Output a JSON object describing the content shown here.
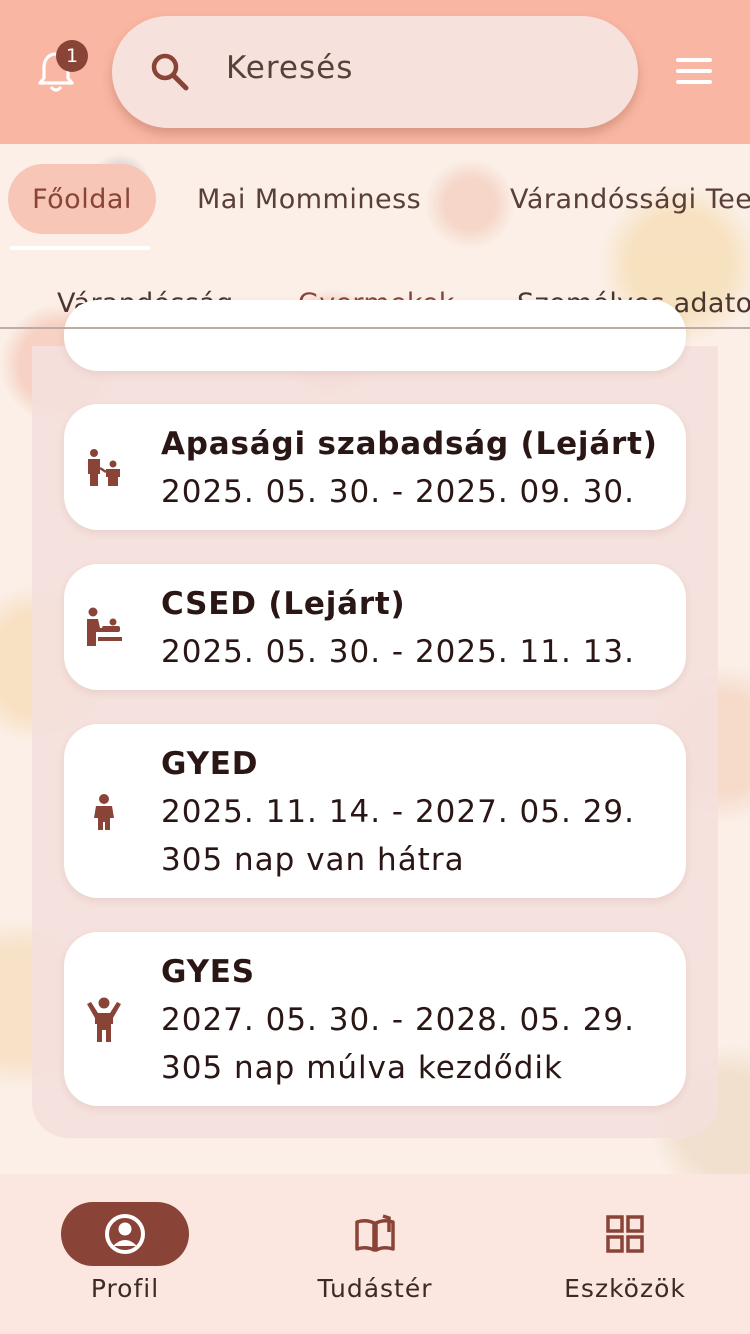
{
  "header": {
    "notification_count": "1",
    "search_placeholder": "Keresés"
  },
  "primary_tabs": [
    {
      "label": "Főoldal",
      "active": true
    },
    {
      "label": "Mai Momminess",
      "active": false
    },
    {
      "label": "Várandóssági Tee",
      "active": false
    }
  ],
  "secondary_tabs": [
    {
      "label": "Várandósság",
      "active": false
    },
    {
      "label": "Gyermekek",
      "active": true
    },
    {
      "label": "Személyes adatok",
      "active": false
    }
  ],
  "cards": [
    {
      "icon": "parent-child-icon",
      "title": "Apasági szabadság (Lejárt)",
      "dates": "2025. 05. 30. - 2025. 09. 30.",
      "note": ""
    },
    {
      "icon": "baby-changing-icon",
      "title": "CSED (Lejárt)",
      "dates": "2025. 05. 30. - 2025. 11. 13.",
      "note": ""
    },
    {
      "icon": "child-icon",
      "title": "GYED",
      "dates": "2025. 11. 14. - 2027. 05. 29.",
      "note": "305 nap van hátra"
    },
    {
      "icon": "child-arms-up-icon",
      "title": "GYES",
      "dates": "2027. 05. 30. - 2028. 05. 29.",
      "note": "305 nap múlva kezdődik"
    }
  ],
  "bottom_nav": [
    {
      "label": "Profil",
      "icon": "profile-icon",
      "active": true
    },
    {
      "label": "Tudástér",
      "icon": "book-icon",
      "active": false
    },
    {
      "label": "Eszközök",
      "icon": "grid-icon",
      "active": false
    }
  ],
  "colors": {
    "accent": "#8a4437",
    "header_bg": "#f9b6a2",
    "active_tab_bg": "#f7c6b7"
  }
}
